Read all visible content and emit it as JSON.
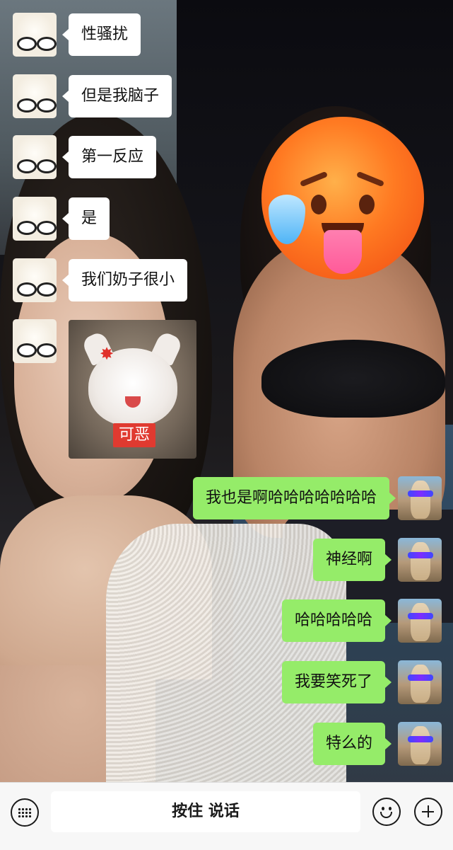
{
  "messages": [
    {
      "side": "in",
      "type": "text",
      "text": "性骚扰"
    },
    {
      "side": "in",
      "type": "text",
      "text": "但是我脑子"
    },
    {
      "side": "in",
      "type": "text",
      "text": "第一反应"
    },
    {
      "side": "in",
      "type": "text",
      "text": "是"
    },
    {
      "side": "in",
      "type": "text",
      "text": "我们奶子很小"
    },
    {
      "side": "in",
      "type": "sticker",
      "caption": "可恶"
    },
    {
      "side": "out",
      "type": "text",
      "text": "我也是啊哈哈哈哈哈哈哈"
    },
    {
      "side": "out",
      "type": "text",
      "text": "神经啊"
    },
    {
      "side": "out",
      "type": "text",
      "text": "哈哈哈哈哈"
    },
    {
      "side": "out",
      "type": "text",
      "text": "我要笑死了"
    },
    {
      "side": "out",
      "type": "text",
      "text": "特么的"
    }
  ],
  "input_bar": {
    "voice_button_label": "按住 说话",
    "left_icon": "keyboard-icon",
    "right_icons": [
      "emoji-icon",
      "plus-icon"
    ]
  },
  "colors": {
    "outgoing_bubble": "#95ec69",
    "incoming_bubble": "#ffffff",
    "bar_background": "#f7f7f7"
  }
}
